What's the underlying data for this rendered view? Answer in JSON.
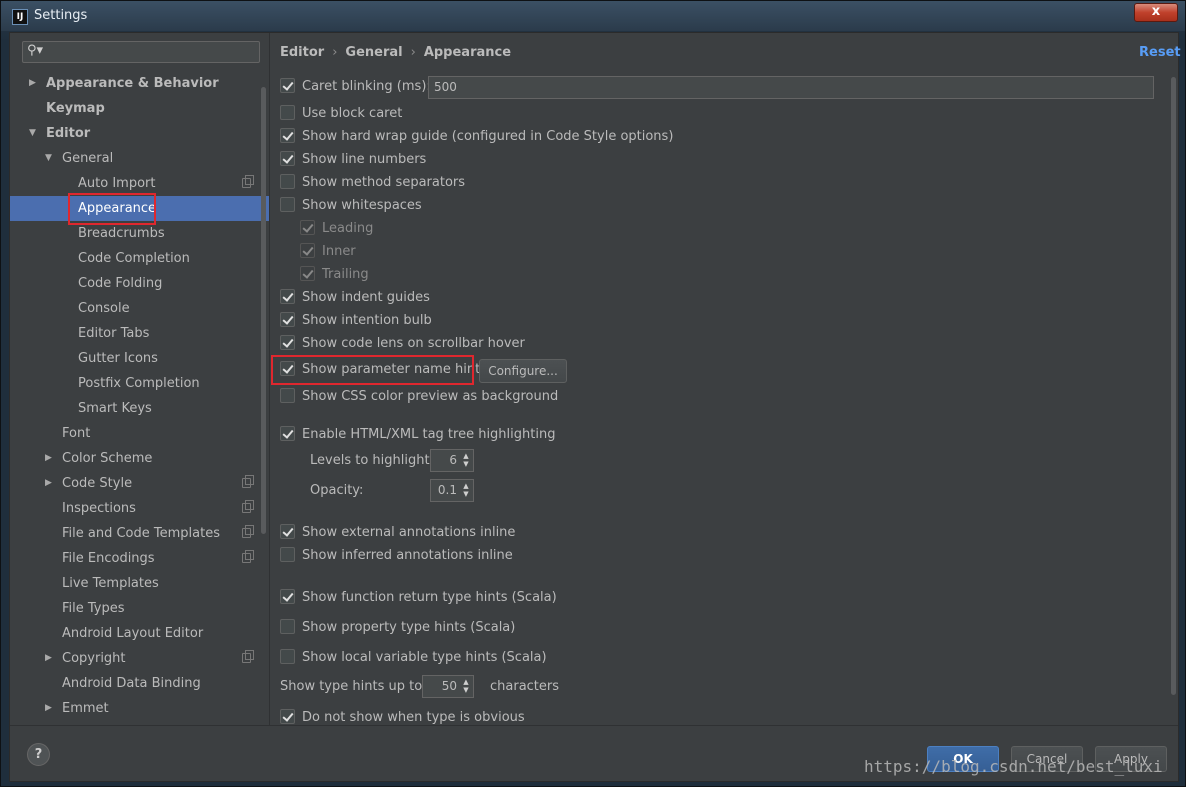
{
  "window": {
    "title": "Settings",
    "app_icon": "IJ",
    "close": "x"
  },
  "search": {
    "placeholder": ""
  },
  "tree": {
    "appearance_behavior": "Appearance & Behavior",
    "keymap": "Keymap",
    "editor": "Editor",
    "general": "General",
    "auto_import": "Auto Import",
    "appearance": "Appearance",
    "breadcrumbs": "Breadcrumbs",
    "code_completion": "Code Completion",
    "code_folding": "Code Folding",
    "console": "Console",
    "editor_tabs": "Editor Tabs",
    "gutter_icons": "Gutter Icons",
    "postfix_completion": "Postfix Completion",
    "smart_keys": "Smart Keys",
    "font": "Font",
    "color_scheme": "Color Scheme",
    "code_style": "Code Style",
    "inspections": "Inspections",
    "file_code_templates": "File and Code Templates",
    "file_encodings": "File Encodings",
    "live_templates": "Live Templates",
    "file_types": "File Types",
    "android_layout_editor": "Android Layout Editor",
    "copyright": "Copyright",
    "android_data_binding": "Android Data Binding",
    "emmet": "Emmet"
  },
  "breadcrumb": {
    "editor": "Editor",
    "general": "General",
    "appearance": "Appearance",
    "separator": "›"
  },
  "reset": "Reset",
  "options": {
    "caret_blinking": "Caret blinking (ms):",
    "caret_blinking_value": "500",
    "block_caret": "Use block caret",
    "hard_wrap": "Show hard wrap guide (configured in Code Style options)",
    "line_numbers": "Show line numbers",
    "method_separators": "Show method separators",
    "whitespaces": "Show whitespaces",
    "leading": "Leading",
    "inner": "Inner",
    "trailing": "Trailing",
    "indent_guides": "Show indent guides",
    "intention_bulb": "Show intention bulb",
    "code_lens": "Show code lens on scrollbar hover",
    "param_hints": "Show parameter name hints",
    "configure": "Configure...",
    "css_preview": "Show CSS color preview as background",
    "tag_tree": "Enable HTML/XML tag tree highlighting",
    "levels_label": "Levels to highlight:",
    "levels_value": "6",
    "opacity_label": "Opacity:",
    "opacity_value": "0.1",
    "external_annotations": "Show external annotations inline",
    "inferred_annotations": "Show inferred annotations inline",
    "func_return_hints": "Show function return type hints (Scala)",
    "property_hints": "Show property type hints (Scala)",
    "local_var_hints": "Show local variable type hints (Scala)",
    "type_hints_up_to": "Show type hints up to:",
    "type_hints_value": "50",
    "characters": "characters",
    "not_obvious": "Do not show when type is obvious"
  },
  "footer": {
    "help": "?",
    "ok": "OK",
    "cancel": "Cancel",
    "apply": "Apply"
  },
  "watermark": "https://blog.csdn.net/best_luxi",
  "colors": {
    "background": "#3c3f41",
    "selection": "#4b6eaf",
    "link": "#589df6",
    "highlight_box": "#e0272e"
  }
}
